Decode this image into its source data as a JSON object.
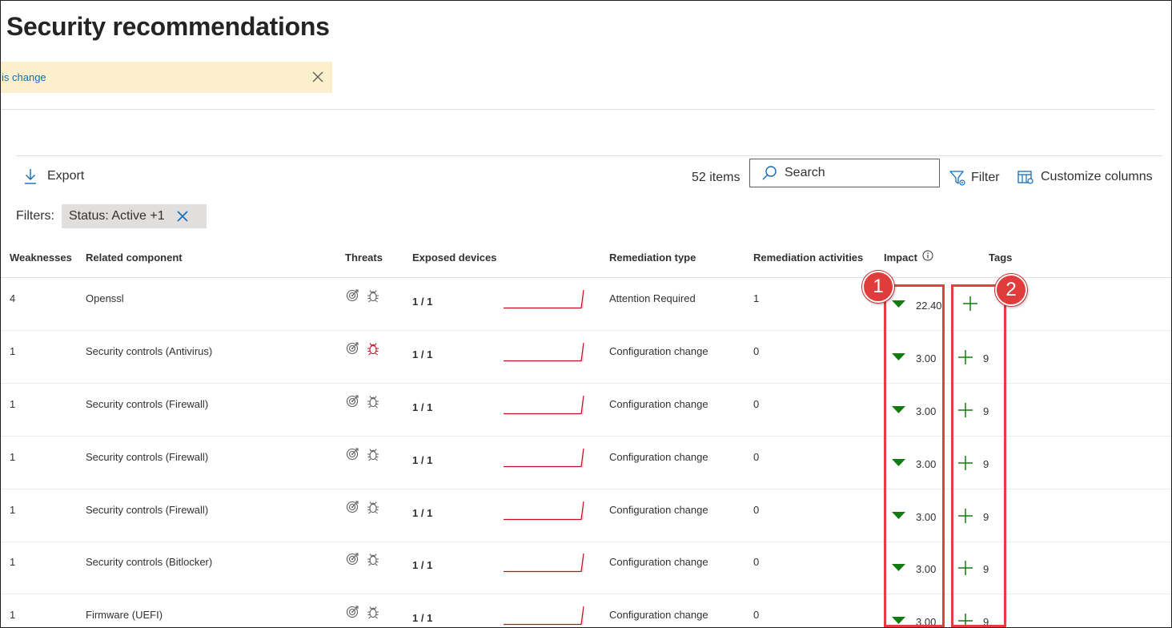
{
  "page": {
    "title": "Security recommendations"
  },
  "notice": {
    "text": "is change"
  },
  "toolbar": {
    "export_label": "Export",
    "items_count": "52 items",
    "search_placeholder": "Search",
    "filter_label": "Filter",
    "customize_label": "Customize columns"
  },
  "filters": {
    "label": "Filters:",
    "chip": "Status: Active +1"
  },
  "columns": {
    "weaknesses": "Weaknesses",
    "component": "Related component",
    "threats": "Threats",
    "exposed": "Exposed devices",
    "remediation_type": "Remediation type",
    "remediation_activities": "Remediation activities",
    "impact": "Impact",
    "tags": "Tags"
  },
  "rows": [
    {
      "weaknesses": "4",
      "component": "Openssl",
      "exposed": "1 / 1",
      "remediation_type": "Attention Required",
      "activities": "1",
      "impact": "22.40",
      "tags": "",
      "bug_active": false
    },
    {
      "weaknesses": "1",
      "component": "Security controls (Antivirus)",
      "exposed": "1 / 1",
      "remediation_type": "Configuration change",
      "activities": "0",
      "impact": "3.00",
      "tags": "9",
      "bug_active": true
    },
    {
      "weaknesses": "1",
      "component": "Security controls (Firewall)",
      "exposed": "1 / 1",
      "remediation_type": "Configuration change",
      "activities": "0",
      "impact": "3.00",
      "tags": "9",
      "bug_active": false
    },
    {
      "weaknesses": "1",
      "component": "Security controls (Firewall)",
      "exposed": "1 / 1",
      "remediation_type": "Configuration change",
      "activities": "0",
      "impact": "3.00",
      "tags": "9",
      "bug_active": false
    },
    {
      "weaknesses": "1",
      "component": "Security controls (Firewall)",
      "exposed": "1 / 1",
      "remediation_type": "Configuration change",
      "activities": "0",
      "impact": "3.00",
      "tags": "9",
      "bug_active": false
    },
    {
      "weaknesses": "1",
      "component": "Security controls (Bitlocker)",
      "exposed": "1 / 1",
      "remediation_type": "Configuration change",
      "activities": "0",
      "impact": "3.00",
      "tags": "9",
      "bug_active": false
    },
    {
      "weaknesses": "1",
      "component": "Firmware (UEFI)",
      "exposed": "1 / 1",
      "remediation_type": "Configuration change",
      "activities": "0",
      "impact": "3.00",
      "tags": "9",
      "bug_active": false
    }
  ],
  "callouts": [
    "1",
    "2"
  ],
  "colors": {
    "accent": "#0f6cbd",
    "impact_arrow": "#107c10",
    "tag_plus": "#107c10",
    "spark": "#c50f1f",
    "highlight": "#e04040",
    "bug_active": "#c50f1f"
  },
  "icons": [
    "download-icon",
    "search-icon",
    "filter-icon",
    "customize-columns-icon",
    "close-icon",
    "info-icon",
    "target-icon",
    "bug-icon",
    "arrow-down-icon",
    "plus-icon"
  ]
}
